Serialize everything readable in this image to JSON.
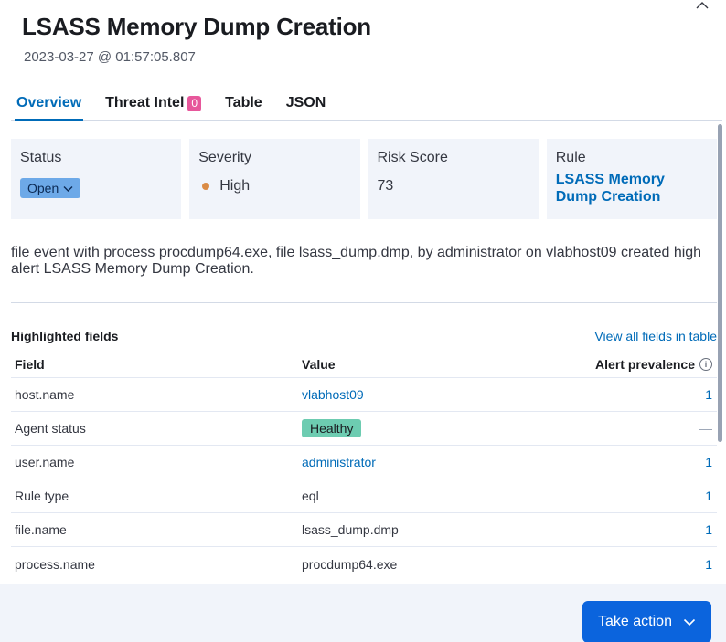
{
  "flyout": {
    "title": "LSASS Memory Dump Creation",
    "timestamp": "2023-03-27 @ 01:57:05.807"
  },
  "tabs": [
    {
      "label": "Overview",
      "active": true
    },
    {
      "label": "Threat Intel",
      "badge": "0"
    },
    {
      "label": "Table"
    },
    {
      "label": "JSON"
    }
  ],
  "summary": {
    "status": {
      "label": "Status",
      "value": "Open"
    },
    "severity": {
      "label": "Severity",
      "value": "High",
      "color": "#da8b45"
    },
    "risk": {
      "label": "Risk Score",
      "value": "73"
    },
    "rule": {
      "label": "Rule",
      "value": "LSASS Memory Dump Creation"
    }
  },
  "reason": "file event with process procdump64.exe, file lsass_dump.dmp, by administrator on vlabhost09 created high alert LSASS Memory Dump Creation.",
  "highlighted": {
    "title": "Highlighted fields",
    "view_all": "View all fields in table",
    "columns": {
      "field": "Field",
      "value": "Value",
      "prevalence": "Alert prevalence"
    },
    "rows": [
      {
        "field": "host.name",
        "value": "vlabhost09",
        "prevalence": "1"
      },
      {
        "field": "Agent status",
        "value": "Healthy",
        "prevalence": "—"
      },
      {
        "field": "user.name",
        "value": "administrator",
        "prevalence": "1"
      },
      {
        "field": "Rule type",
        "value": "eql",
        "prevalence": "1"
      },
      {
        "field": "file.name",
        "value": "lsass_dump.dmp",
        "prevalence": "1"
      },
      {
        "field": "process.name",
        "value": "procdump64.exe",
        "prevalence": "1"
      }
    ]
  },
  "footer": {
    "action_label": "Take action"
  },
  "colors": {
    "accent": "#006bb8",
    "primary_button": "#0b64dd",
    "healthy": "#6dccb1",
    "badge": "#e7579b"
  }
}
